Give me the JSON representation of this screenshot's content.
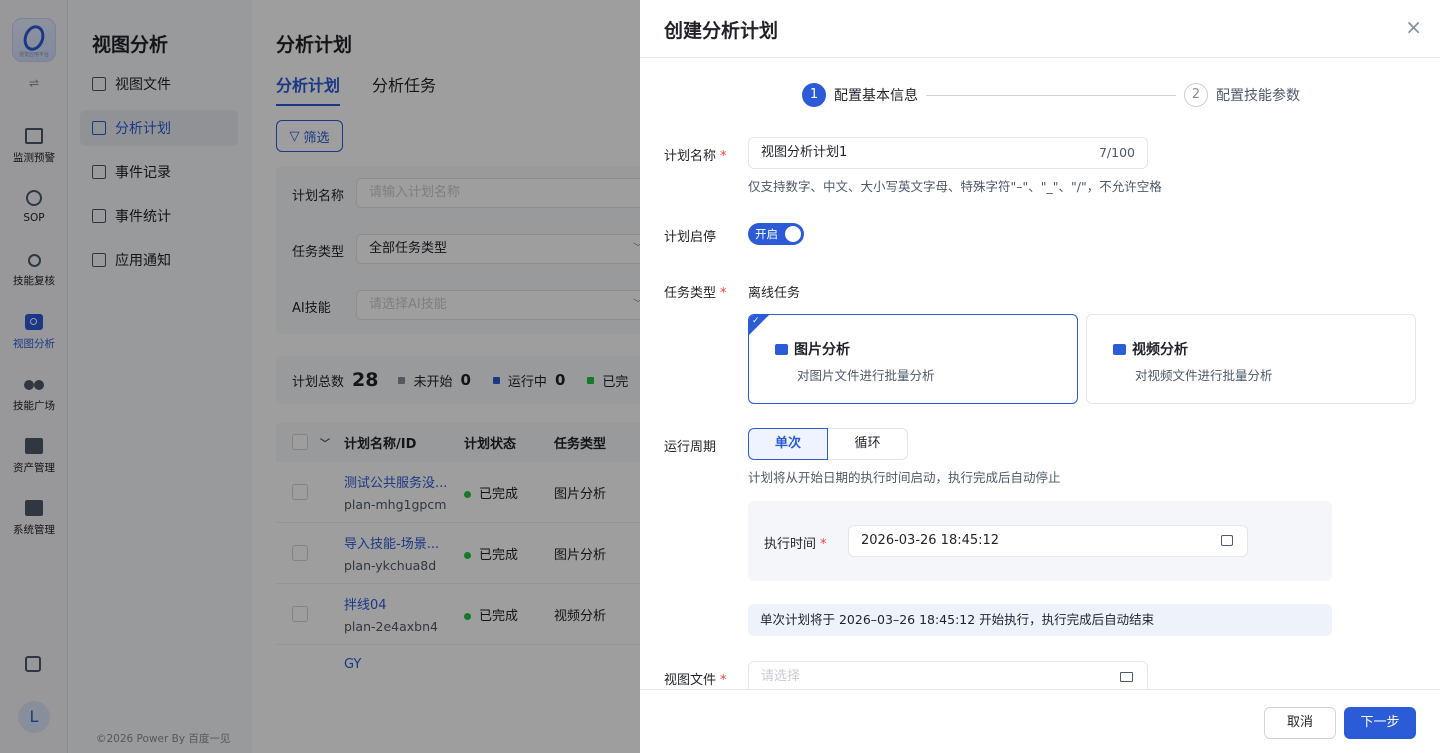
{
  "rail": {
    "logo_caption": "视觉应用平台",
    "items": [
      {
        "label": "监测预警",
        "icon": "monitor-icon"
      },
      {
        "label": "SOP",
        "icon": "sop-icon"
      },
      {
        "label": "技能复核",
        "icon": "review-icon"
      },
      {
        "label": "视图分析",
        "icon": "view-analysis-icon"
      },
      {
        "label": "技能广场",
        "icon": "skill-plaza-icon"
      },
      {
        "label": "资产管理",
        "icon": "asset-icon"
      },
      {
        "label": "系统管理",
        "icon": "system-icon"
      }
    ],
    "toggle_glyph": "⇌",
    "avatar_letter": "L"
  },
  "sidebar": {
    "title": "视图分析",
    "items": [
      {
        "label": "视图文件"
      },
      {
        "label": "分析计划"
      },
      {
        "label": "事件记录"
      },
      {
        "label": "事件统计"
      },
      {
        "label": "应用通知"
      }
    ],
    "footer": "©2026 Power By 百度一见"
  },
  "main": {
    "title": "分析计划",
    "tabs": [
      {
        "label": "分析计划"
      },
      {
        "label": "分析任务"
      }
    ],
    "filter_button": "筛选",
    "filters": {
      "name_label": "计划名称",
      "name_placeholder": "请输入计划名称",
      "type_label": "任务类型",
      "type_value": "全部任务类型",
      "ai_label": "AI技能",
      "ai_placeholder": "请选择AI技能"
    },
    "stats": {
      "total_label": "计划总数",
      "total": "28",
      "not_started_label": "未开始",
      "not_started": "0",
      "running_label": "运行中",
      "running": "0",
      "done_label": "已完"
    },
    "table": {
      "headers": {
        "name": "计划名称/ID",
        "status": "计划状态",
        "type": "任务类型"
      },
      "rows": [
        {
          "name": "测试公共服务没...",
          "id": "plan-mhg1gpcm",
          "status": "已完成",
          "type": "图片分析"
        },
        {
          "name": "导入技能-场景...",
          "id": "plan-ykchua8d",
          "status": "已完成",
          "type": "图片分析"
        },
        {
          "name": "拌线04",
          "id": "plan-2e4axbn4",
          "status": "已完成",
          "type": "视频分析"
        },
        {
          "name": "GY",
          "id": "",
          "status": "",
          "type": ""
        }
      ]
    }
  },
  "drawer": {
    "title": "创建分析计划",
    "steps": [
      {
        "num": "1",
        "label": "配置基本信息"
      },
      {
        "num": "2",
        "label": "配置技能参数"
      }
    ],
    "plan_name": {
      "label": "计划名称",
      "value": "视图分析计划1",
      "count": "7/100",
      "hint": "仅支持数字、中文、大小写英文字母、特殊字符\"–\"、\"_\"、\"/\"，不允许空格"
    },
    "plan_switch": {
      "label": "计划启停",
      "state": "开启"
    },
    "task_type": {
      "label": "任务类型",
      "value": "离线任务",
      "cards": [
        {
          "title": "图片分析",
          "desc": "对图片文件进行批量分析"
        },
        {
          "title": "视频分析",
          "desc": "对视频文件进行批量分析"
        }
      ]
    },
    "cycle": {
      "label": "运行周期",
      "options": [
        "单次",
        "循环"
      ],
      "hint": "计划将从开始日期的执行时间启动，执行完成后自动停止",
      "exec_label": "执行时间",
      "exec_value": "2026-03-26 18:45:12",
      "notice": "单次计划将于 2026–03–26 18:45:12 开始执行，执行完成后自动结束"
    },
    "view_file": {
      "label": "视图文件",
      "placeholder": "请选择"
    },
    "buttons": {
      "cancel": "取消",
      "next": "下一步"
    },
    "required_mark": "*",
    "close_glyph": "×"
  },
  "colors": {
    "primary": "#2b5bd7",
    "success": "#23c343",
    "danger": "#f53f3f"
  }
}
